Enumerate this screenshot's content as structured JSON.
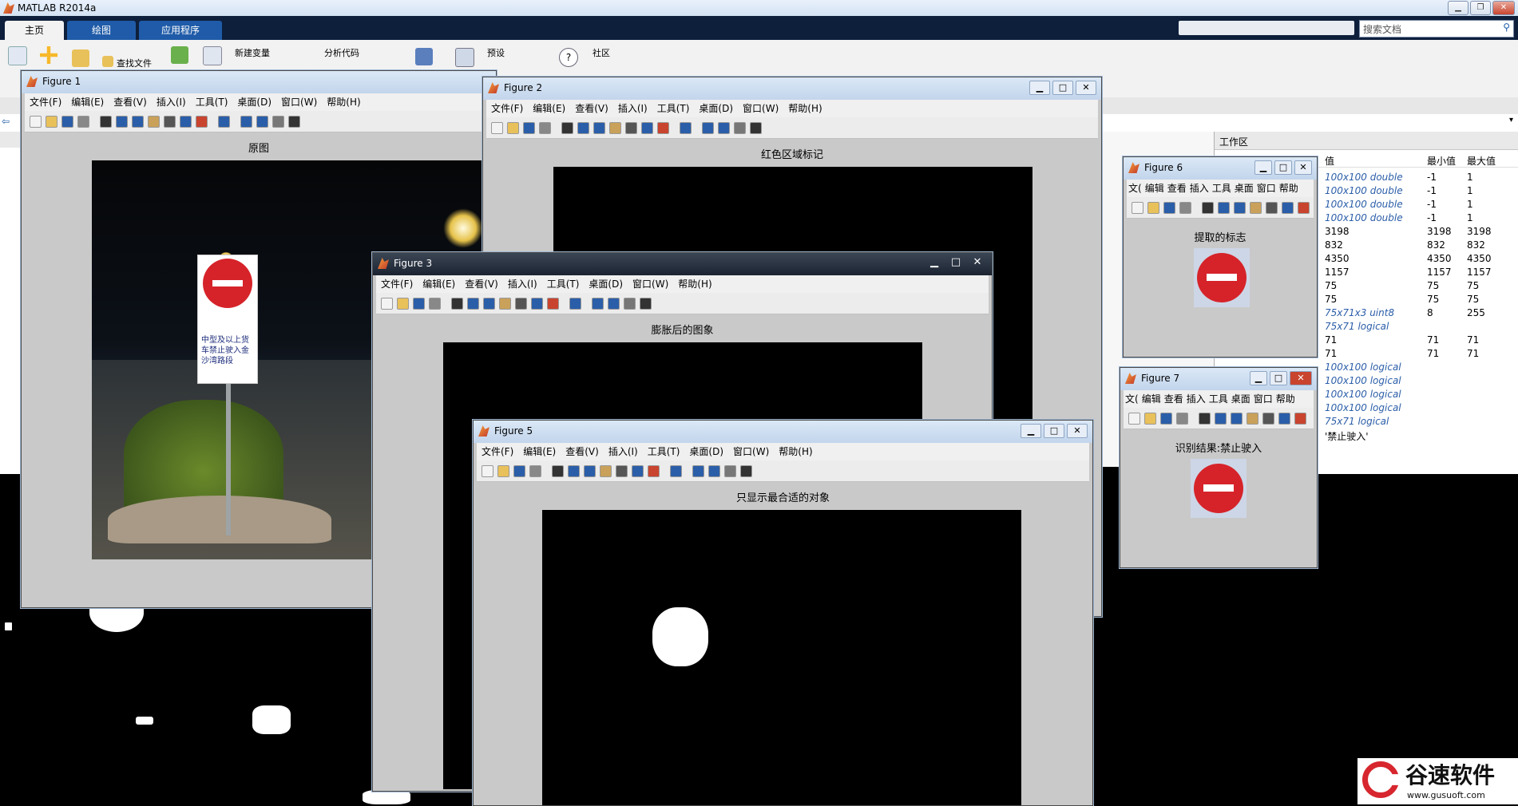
{
  "app": {
    "title": "MATLAB R2014a",
    "tabs": [
      "主页",
      "绘图",
      "应用程序"
    ],
    "search_placeholder": "搜索文档",
    "ribbon": {
      "find_files": "查找文件",
      "new_variable": "新建变量",
      "analyze_code": "分析代码",
      "preferences": "预设",
      "community": "社区"
    },
    "workspace": {
      "title": "工作区",
      "columns": [
        "值",
        "最小值",
        "最大值"
      ],
      "rows": [
        {
          "value": "100x100 double",
          "min": "-1",
          "max": "1"
        },
        {
          "value": "100x100 double",
          "min": "-1",
          "max": "1"
        },
        {
          "value": "100x100 double",
          "min": "-1",
          "max": "1"
        },
        {
          "value": "100x100 double",
          "min": "-1",
          "max": "1"
        },
        {
          "value": "3198",
          "min": "3198",
          "max": "3198"
        },
        {
          "value": "832",
          "min": "832",
          "max": "832"
        },
        {
          "value": "4350",
          "min": "4350",
          "max": "4350"
        },
        {
          "value": "1157",
          "min": "1157",
          "max": "1157"
        },
        {
          "value": "75",
          "min": "75",
          "max": "75"
        },
        {
          "value": "75",
          "min": "75",
          "max": "75"
        },
        {
          "value": "75x71x3 uint8",
          "min": "8",
          "max": "255"
        },
        {
          "value": "75x71 logical",
          "min": "",
          "max": ""
        },
        {
          "value": "71",
          "min": "71",
          "max": "71"
        },
        {
          "value": "71",
          "min": "71",
          "max": "71"
        },
        {
          "value": "100x100 logical",
          "min": "",
          "max": ""
        },
        {
          "value": "100x100 logical",
          "min": "",
          "max": ""
        },
        {
          "value": "100x100 logical",
          "min": "",
          "max": ""
        },
        {
          "value": "100x100 logical",
          "min": "",
          "max": ""
        },
        {
          "value": "75x71 logical",
          "min": "",
          "max": ""
        },
        {
          "value": "'禁止驶入'",
          "min": "",
          "max": ""
        }
      ],
      "italic_color": "#2b5ea8"
    }
  },
  "menu_full": [
    "文件(F)",
    "编辑(E)",
    "查看(V)",
    "插入(I)",
    "工具(T)",
    "桌面(D)",
    "窗口(W)",
    "帮助(H)"
  ],
  "menu_short": [
    "文(",
    "编辑",
    "查看",
    "插入",
    "工具",
    "桌面",
    "窗口",
    "帮助"
  ],
  "figures": {
    "f1": {
      "name": "Figure 1",
      "plot_title": "原图"
    },
    "f2": {
      "name": "Figure 2",
      "plot_title": "红色区域标记"
    },
    "f3": {
      "name": "Figure 3",
      "plot_title": "膨胀后的图象"
    },
    "f5": {
      "name": "Figure 5",
      "plot_title": "只显示最合适的对象"
    },
    "f6": {
      "name": "Figure 6",
      "plot_title": "提取的标志"
    },
    "f7": {
      "name": "Figure 7",
      "plot_title": "识别结果:禁止驶入"
    }
  },
  "sign_text": "中型及以上货车禁止驶入金沙湾路段",
  "watermark": {
    "brand": "谷速软件",
    "url": "www.gusuoft.com"
  },
  "colors": {
    "ribbon_tab_bg": "#0e1f3c",
    "active_tab": "#1f5ba8",
    "sign_red": "#d6232a"
  }
}
